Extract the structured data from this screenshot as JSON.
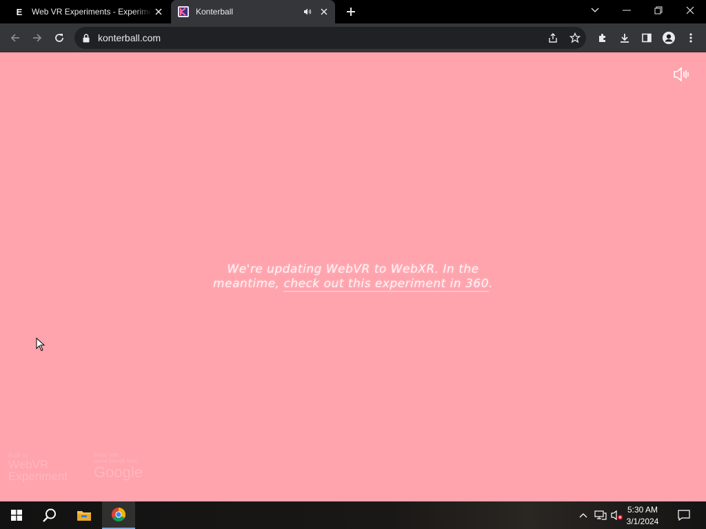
{
  "browser": {
    "tabs": [
      {
        "title": "Web VR Experiments - Experiments with Google",
        "favicon": "E",
        "active": false
      },
      {
        "title": "Konterball",
        "favicon": "konterball-k-icon",
        "active": true,
        "audio": true
      }
    ],
    "url": "konterball.com"
  },
  "page": {
    "background": "#ffa3ad",
    "message_line1": "We're updating WebVR to WebXR. In the",
    "message_line2_prefix": "meantime, ",
    "message_link": "check out this experiment in 360",
    "message_suffix": ".",
    "badge_webvr_small": "Built in",
    "badge_webvr_line1": "WebVR",
    "badge_webvr_line2": "Experiment",
    "badge_google_small1": "Made with",
    "badge_google_small2": "some friends from",
    "badge_google_big": "Google"
  },
  "taskbar": {
    "time": "5:30 AM",
    "date": "3/1/2024"
  }
}
